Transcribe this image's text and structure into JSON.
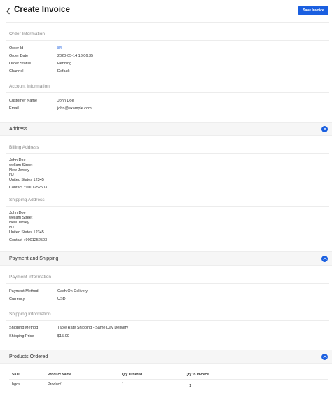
{
  "header": {
    "title": "Create Invoice",
    "save_label": "Save Invoice"
  },
  "order_information": {
    "title": "Order Information",
    "rows": [
      {
        "label": "Order Id",
        "value": "84"
      },
      {
        "label": "Order Date",
        "value": "2020-05-14 13:06:35"
      },
      {
        "label": "Order Status",
        "value": "Pending"
      },
      {
        "label": "Channel",
        "value": "Default"
      }
    ]
  },
  "account_information": {
    "title": "Account Information",
    "rows": [
      {
        "label": "Customer Name",
        "value": "John Doe"
      },
      {
        "label": "Email",
        "value": "john@example.com"
      }
    ]
  },
  "address": {
    "title": "Address",
    "billing": {
      "title": "Billing Address",
      "lines": [
        "John Doe",
        "wellam Street",
        "New Jersey",
        "NJ",
        "United States 12345"
      ],
      "contact": "Contact : 9001252503"
    },
    "shipping": {
      "title": "Shipping Address",
      "lines": [
        "John Doe",
        "wellam Street",
        "New Jersey",
        "NJ",
        "United States 12345"
      ],
      "contact": "Contact : 9001252503"
    }
  },
  "payment_and_shipping": {
    "title": "Payment and Shipping",
    "payment": {
      "title": "Payment Information",
      "rows": [
        {
          "label": "Payment Method",
          "value": "Cash On Delivery"
        },
        {
          "label": "Currency",
          "value": "USD"
        }
      ]
    },
    "shipping": {
      "title": "Shipping Information",
      "rows": [
        {
          "label": "Shipping Method",
          "value": "Table Rate Shipping - Same Day Delivery"
        },
        {
          "label": "Shipping Price",
          "value": "$15.00"
        }
      ]
    }
  },
  "products_ordered": {
    "title": "Products Ordered",
    "columns": [
      "SKU",
      "Product Name",
      "Qty Ordered",
      "Qty to Invoice"
    ],
    "rows": [
      {
        "sku": "hgds",
        "product_name": "Product1",
        "qty_ordered": "1",
        "qty_to_invoice": "1"
      }
    ]
  },
  "colors": {
    "accent": "#1a5fe0",
    "band_background": "#f6f6f6",
    "muted_text": "#8a8a8a"
  },
  "icons": {
    "back": "chevron-left-icon",
    "collapse": "chevron-up-icon"
  }
}
